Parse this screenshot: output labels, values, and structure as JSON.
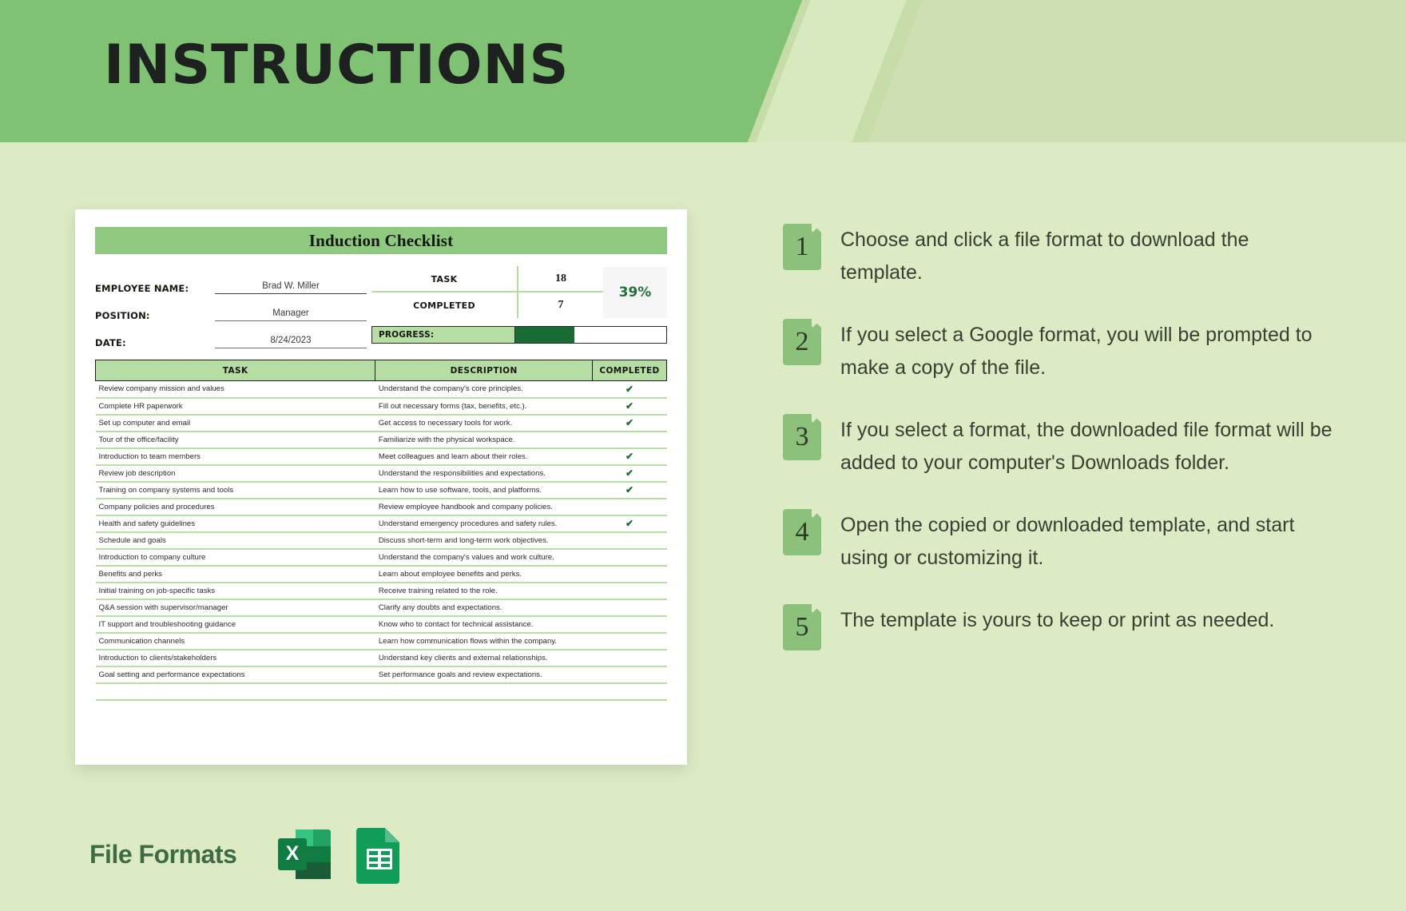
{
  "header": {
    "title": "INSTRUCTIONS"
  },
  "colors": {
    "page_bg": "#dcebc4",
    "banner_green": "#80c273",
    "accent_green": "#8ec97f",
    "table_header": "#b6dda4",
    "progress_fill": "#186b33",
    "percent_text": "#23703a",
    "excel_green": "#107c41",
    "sheets_green": "#0f9d58"
  },
  "document": {
    "title": "Induction Checklist",
    "meta": [
      {
        "label": "EMPLOYEE NAME:",
        "value": "Brad W. Miller"
      },
      {
        "label": "POSITION:",
        "value": "Manager"
      },
      {
        "label": "DATE:",
        "value": "8/24/2023"
      }
    ],
    "stats": [
      {
        "name": "TASK",
        "value": "18"
      },
      {
        "name": "COMPLETED",
        "value": "7"
      }
    ],
    "percent": "39%",
    "percent_value": 39,
    "progress_label": "PROGRESS:",
    "table": {
      "columns": [
        "TASK",
        "DESCRIPTION",
        "COMPLETED"
      ],
      "check_glyph": "✔",
      "rows": [
        {
          "task": "Review company mission and values",
          "description": "Understand the company's core principles.",
          "completed": true
        },
        {
          "task": "Complete HR paperwork",
          "description": "Fill out necessary forms (tax, benefits, etc.).",
          "completed": true
        },
        {
          "task": "Set up computer and email",
          "description": "Get access to necessary tools for work.",
          "completed": true
        },
        {
          "task": "Tour of the office/facility",
          "description": "Familiarize with the physical workspace.",
          "completed": false
        },
        {
          "task": "Introduction to team members",
          "description": "Meet colleagues and learn about their roles.",
          "completed": true
        },
        {
          "task": "Review job description",
          "description": "Understand the responsibilities and expectations.",
          "completed": true
        },
        {
          "task": "Training on company systems and tools",
          "description": "Learn how to use software, tools, and platforms.",
          "completed": true
        },
        {
          "task": "Company policies and procedures",
          "description": "Review employee handbook and company policies.",
          "completed": false
        },
        {
          "task": "Health and safety guidelines",
          "description": "Understand emergency procedures and safety rules.",
          "completed": true
        },
        {
          "task": "Schedule and goals",
          "description": "Discuss short-term and long-term work objectives.",
          "completed": false
        },
        {
          "task": "Introduction to company culture",
          "description": "Understand the company's values and work culture.",
          "completed": false
        },
        {
          "task": "Benefits and perks",
          "description": "Learn about employee benefits and perks.",
          "completed": false
        },
        {
          "task": "Initial training on job-specific tasks",
          "description": "Receive training related to the role.",
          "completed": false
        },
        {
          "task": "Q&A session with supervisor/manager",
          "description": "Clarify any doubts and expectations.",
          "completed": false
        },
        {
          "task": "IT support and troubleshooting guidance",
          "description": "Know who to contact for technical assistance.",
          "completed": false
        },
        {
          "task": "Communication channels",
          "description": "Learn how communication flows within the company.",
          "completed": false
        },
        {
          "task": "Introduction to clients/stakeholders",
          "description": "Understand key clients and external relationships.",
          "completed": false
        },
        {
          "task": "Goal setting and performance expectations",
          "description": "Set performance goals and review expectations.",
          "completed": false
        }
      ]
    }
  },
  "steps": [
    {
      "number": "1",
      "text": "Choose and click a file format to download the template."
    },
    {
      "number": "2",
      "text": "If you select a Google format, you will be prompted to make a copy of the file."
    },
    {
      "number": "3",
      "text": "If you select a format, the downloaded file format will be added to your computer's Downloads folder."
    },
    {
      "number": "4",
      "text": "Open the copied or downloaded template, and start using or customizing it."
    },
    {
      "number": "5",
      "text": "The template is yours to keep or print as needed."
    }
  ],
  "file_formats": {
    "label": "File Formats",
    "items": [
      {
        "name": "excel-icon",
        "letter": "X"
      },
      {
        "name": "google-sheets-icon",
        "letter": ""
      }
    ]
  }
}
